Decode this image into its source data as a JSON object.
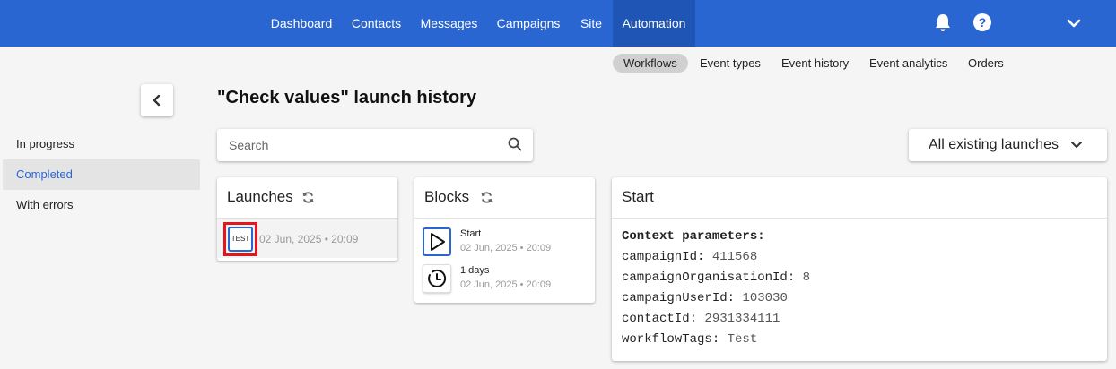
{
  "topnav": {
    "items": [
      "Dashboard",
      "Contacts",
      "Messages",
      "Campaigns",
      "Site",
      "Automation"
    ],
    "active": "Automation"
  },
  "subnav": {
    "items": [
      "Workflows",
      "Event types",
      "Event history",
      "Event analytics",
      "Orders"
    ],
    "active": "Workflows"
  },
  "page": {
    "title": "\"Check values\" launch history"
  },
  "sidebar": {
    "items": [
      {
        "label": "In progress"
      },
      {
        "label": "Completed"
      },
      {
        "label": "With errors"
      }
    ],
    "active": "Completed"
  },
  "search": {
    "placeholder": "Search",
    "value": ""
  },
  "filter": {
    "selected": "All existing launches"
  },
  "launches": {
    "title": "Launches",
    "items": [
      {
        "badge": "TEST",
        "time": "02 Jun, 2025 • 20:09"
      }
    ]
  },
  "blocks": {
    "title": "Blocks",
    "items": [
      {
        "name": "Start",
        "time": "02 Jun, 2025 • 20:09",
        "icon": "play-icon"
      },
      {
        "name": "1 days",
        "time": "02 Jun, 2025 • 20:09",
        "icon": "clock-icon"
      }
    ]
  },
  "details": {
    "title": "Start",
    "heading": "Context parameters:",
    "params": [
      {
        "key": "campaignId:",
        "value": "411568"
      },
      {
        "key": "campaignOrganisationId:",
        "value": "8"
      },
      {
        "key": "campaignUserId:",
        "value": "103030"
      },
      {
        "key": "contactId:",
        "value": "2931334111"
      },
      {
        "key": "workflowTags:",
        "value": "Test"
      }
    ]
  },
  "colors": {
    "brand": "#2a66d1",
    "highlight": "#e4161c"
  }
}
